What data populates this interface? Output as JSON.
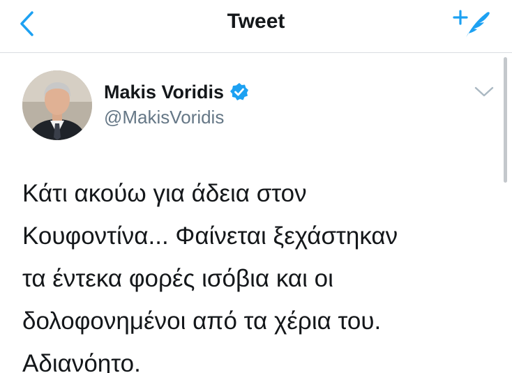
{
  "header": {
    "title": "Tweet",
    "back_icon": "chevron-left-icon",
    "compose_icon": "compose-tweet-icon"
  },
  "tweet": {
    "author": {
      "name": "Makis Voridis",
      "handle": "@MakisVoridis",
      "verified": true
    },
    "text_lines": [
      "Κάτι ακούω για άδεια στον",
      "Κουφοντίνα... Φαίνεται ξεχάστηκαν",
      "τα έντεκα φορές ισόβια και οι",
      "δολοφονημένοι από τα χέρια του.",
      "Αδιανόητο."
    ]
  },
  "colors": {
    "accent": "#1da1f2",
    "text": "#14171a",
    "secondary": "#657786"
  }
}
